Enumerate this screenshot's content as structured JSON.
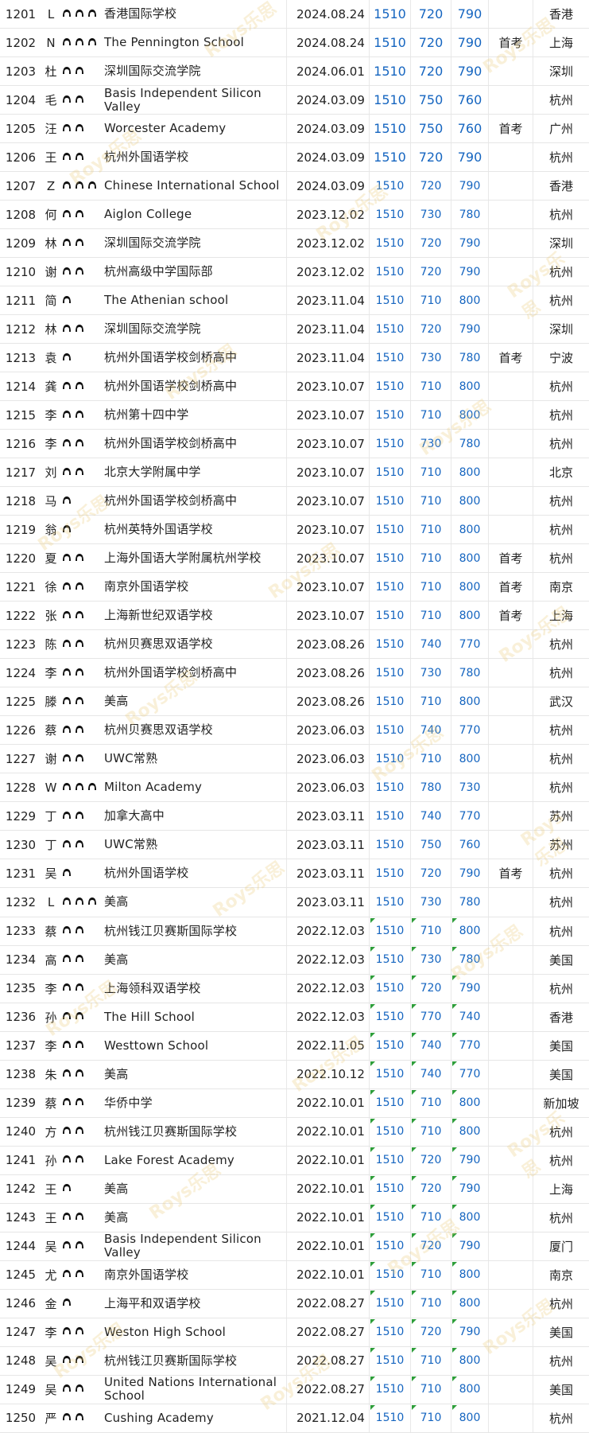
{
  "watermark": "Roys乐思",
  "rows": [
    {
      "id": "1201",
      "name": "L",
      "bulbs": 3,
      "school": "香港国际学校",
      "date": "2024.08.24",
      "total": "1510",
      "s1": "720",
      "s2": "790",
      "note": "",
      "city": "香港"
    },
    {
      "id": "1202",
      "name": "N",
      "bulbs": 3,
      "school": "The Pennington School",
      "date": "2024.08.24",
      "total": "1510",
      "s1": "720",
      "s2": "790",
      "note": "首考",
      "city": "上海"
    },
    {
      "id": "1203",
      "name": "杜",
      "bulbs": 2,
      "school": "深圳国际交流学院",
      "date": "2024.06.01",
      "total": "1510",
      "s1": "720",
      "s2": "790",
      "note": "",
      "city": "深圳"
    },
    {
      "id": "1204",
      "name": "毛",
      "bulbs": 2,
      "school": "Basis Independent Silicon Valley",
      "date": "2024.03.09",
      "total": "1510",
      "s1": "750",
      "s2": "760",
      "note": "",
      "city": "杭州"
    },
    {
      "id": "1205",
      "name": "汪",
      "bulbs": 2,
      "school": "Worcester Academy",
      "date": "2024.03.09",
      "total": "1510",
      "s1": "750",
      "s2": "760",
      "note": "首考",
      "city": "广州"
    },
    {
      "id": "1206",
      "name": "王",
      "bulbs": 2,
      "school": "杭州外国语学校",
      "date": "2024.03.09",
      "total": "1510",
      "s1": "720",
      "s2": "790",
      "note": "",
      "city": "杭州"
    },
    {
      "id": "1207",
      "name": "Z",
      "bulbs": 3,
      "school": "Chinese International School",
      "date": "2024.03.09",
      "total": "1510",
      "s1": "720",
      "s2": "790",
      "note": "",
      "city": "香港"
    },
    {
      "id": "1208",
      "name": "何",
      "bulbs": 2,
      "school": "Aiglon College",
      "date": "2023.12.02",
      "total": "1510",
      "s1": "730",
      "s2": "780",
      "note": "",
      "city": "杭州"
    },
    {
      "id": "1209",
      "name": "林",
      "bulbs": 2,
      "school": "深圳国际交流学院",
      "date": "2023.12.02",
      "total": "1510",
      "s1": "720",
      "s2": "790",
      "note": "",
      "city": "深圳"
    },
    {
      "id": "1210",
      "name": "谢",
      "bulbs": 2,
      "school": "杭州高级中学国际部",
      "date": "2023.12.02",
      "total": "1510",
      "s1": "720",
      "s2": "790",
      "note": "",
      "city": "杭州"
    },
    {
      "id": "1211",
      "name": "简",
      "bulbs": 1,
      "school": "The Athenian school",
      "date": "2023.11.04",
      "total": "1510",
      "s1": "710",
      "s2": "800",
      "note": "",
      "city": "杭州"
    },
    {
      "id": "1212",
      "name": "林",
      "bulbs": 2,
      "school": "深圳国际交流学院",
      "date": "2023.11.04",
      "total": "1510",
      "s1": "720",
      "s2": "790",
      "note": "",
      "city": "深圳"
    },
    {
      "id": "1213",
      "name": "袁",
      "bulbs": 1,
      "school": "杭州外国语学校剑桥高中",
      "date": "2023.11.04",
      "total": "1510",
      "s1": "730",
      "s2": "780",
      "note": "首考",
      "city": "宁波"
    },
    {
      "id": "1214",
      "name": "龚",
      "bulbs": 2,
      "school": "杭州外国语学校剑桥高中",
      "date": "2023.10.07",
      "total": "1510",
      "s1": "710",
      "s2": "800",
      "note": "",
      "city": "杭州"
    },
    {
      "id": "1215",
      "name": "李",
      "bulbs": 2,
      "school": "杭州第十四中学",
      "date": "2023.10.07",
      "total": "1510",
      "s1": "710",
      "s2": "800",
      "note": "",
      "city": "杭州"
    },
    {
      "id": "1216",
      "name": "李",
      "bulbs": 2,
      "school": "杭州外国语学校剑桥高中",
      "date": "2023.10.07",
      "total": "1510",
      "s1": "730",
      "s2": "780",
      "note": "",
      "city": "杭州"
    },
    {
      "id": "1217",
      "name": "刘",
      "bulbs": 2,
      "school": "北京大学附属中学",
      "date": "2023.10.07",
      "total": "1510",
      "s1": "710",
      "s2": "800",
      "note": "",
      "city": "北京"
    },
    {
      "id": "1218",
      "name": "马",
      "bulbs": 1,
      "school": "杭州外国语学校剑桥高中",
      "date": "2023.10.07",
      "total": "1510",
      "s1": "710",
      "s2": "800",
      "note": "",
      "city": "杭州"
    },
    {
      "id": "1219",
      "name": "翁",
      "bulbs": 1,
      "school": "杭州英特外国语学校",
      "date": "2023.10.07",
      "total": "1510",
      "s1": "710",
      "s2": "800",
      "note": "",
      "city": "杭州"
    },
    {
      "id": "1220",
      "name": "夏",
      "bulbs": 2,
      "school": "上海外国语大学附属杭州学校",
      "date": "2023.10.07",
      "total": "1510",
      "s1": "710",
      "s2": "800",
      "note": "首考",
      "city": "杭州"
    },
    {
      "id": "1221",
      "name": "徐",
      "bulbs": 2,
      "school": "南京外国语学校",
      "date": "2023.10.07",
      "total": "1510",
      "s1": "710",
      "s2": "800",
      "note": "首考",
      "city": "南京"
    },
    {
      "id": "1222",
      "name": "张",
      "bulbs": 2,
      "school": "上海新世纪双语学校",
      "date": "2023.10.07",
      "total": "1510",
      "s1": "710",
      "s2": "800",
      "note": "首考",
      "city": "上海"
    },
    {
      "id": "1223",
      "name": "陈",
      "bulbs": 2,
      "school": "杭州贝赛思双语学校",
      "date": "2023.08.26",
      "total": "1510",
      "s1": "740",
      "s2": "770",
      "note": "",
      "city": "杭州"
    },
    {
      "id": "1224",
      "name": "李",
      "bulbs": 2,
      "school": "杭州外国语学校剑桥高中",
      "date": "2023.08.26",
      "total": "1510",
      "s1": "730",
      "s2": "780",
      "note": "",
      "city": "杭州"
    },
    {
      "id": "1225",
      "name": "滕",
      "bulbs": 2,
      "school": "美高",
      "date": "2023.08.26",
      "total": "1510",
      "s1": "710",
      "s2": "800",
      "note": "",
      "city": "武汉"
    },
    {
      "id": "1226",
      "name": "蔡",
      "bulbs": 2,
      "school": "杭州贝赛思双语学校",
      "date": "2023.06.03",
      "total": "1510",
      "s1": "740",
      "s2": "770",
      "note": "",
      "city": "杭州"
    },
    {
      "id": "1227",
      "name": "谢",
      "bulbs": 2,
      "school": "UWC常熟",
      "date": "2023.06.03",
      "total": "1510",
      "s1": "710",
      "s2": "800",
      "note": "",
      "city": "杭州"
    },
    {
      "id": "1228",
      "name": "W",
      "bulbs": 3,
      "school": "Milton Academy",
      "date": "2023.06.03",
      "total": "1510",
      "s1": "780",
      "s2": "730",
      "note": "",
      "city": "杭州"
    },
    {
      "id": "1229",
      "name": "丁",
      "bulbs": 2,
      "school": "加拿大高中",
      "date": "2023.03.11",
      "total": "1510",
      "s1": "740",
      "s2": "770",
      "note": "",
      "city": "苏州"
    },
    {
      "id": "1230",
      "name": "丁",
      "bulbs": 2,
      "school": "UWC常熟",
      "date": "2023.03.11",
      "total": "1510",
      "s1": "750",
      "s2": "760",
      "note": "",
      "city": "苏州"
    },
    {
      "id": "1231",
      "name": "吴",
      "bulbs": 1,
      "school": "杭州外国语学校",
      "date": "2023.03.11",
      "total": "1510",
      "s1": "720",
      "s2": "790",
      "note": "首考",
      "city": "杭州"
    },
    {
      "id": "1232",
      "name": "L",
      "bulbs": 3,
      "school": "美高",
      "date": "2023.03.11",
      "total": "1510",
      "s1": "730",
      "s2": "780",
      "note": "",
      "city": "杭州"
    },
    {
      "id": "1233",
      "name": "蔡",
      "bulbs": 2,
      "school": "杭州钱江贝赛斯国际学校",
      "date": "2022.12.03",
      "total": "1510",
      "s1": "710",
      "s2": "800",
      "note": "",
      "city": "杭州",
      "flag": true
    },
    {
      "id": "1234",
      "name": "高",
      "bulbs": 2,
      "school": "美高",
      "date": "2022.12.03",
      "total": "1510",
      "s1": "730",
      "s2": "780",
      "note": "",
      "city": "美国",
      "flag": true
    },
    {
      "id": "1235",
      "name": "李",
      "bulbs": 2,
      "school": "上海领科双语学校",
      "date": "2022.12.03",
      "total": "1510",
      "s1": "720",
      "s2": "790",
      "note": "",
      "city": "杭州",
      "flag": true
    },
    {
      "id": "1236",
      "name": "孙",
      "bulbs": 2,
      "school": "The Hill School",
      "date": "2022.12.03",
      "total": "1510",
      "s1": "770",
      "s2": "740",
      "note": "",
      "city": "香港",
      "flag": true
    },
    {
      "id": "1237",
      "name": "李",
      "bulbs": 2,
      "school": "Westtown School",
      "date": "2022.11.05",
      "total": "1510",
      "s1": "740",
      "s2": "770",
      "note": "",
      "city": "美国",
      "flag": true
    },
    {
      "id": "1238",
      "name": "朱",
      "bulbs": 2,
      "school": "美高",
      "date": "2022.10.12",
      "total": "1510",
      "s1": "740",
      "s2": "770",
      "note": "",
      "city": "美国",
      "flag": true
    },
    {
      "id": "1239",
      "name": "蔡",
      "bulbs": 2,
      "school": "华侨中学",
      "date": "2022.10.01",
      "total": "1510",
      "s1": "710",
      "s2": "800",
      "note": "",
      "city": "新加坡",
      "flag": true
    },
    {
      "id": "1240",
      "name": "方",
      "bulbs": 2,
      "school": "杭州钱江贝赛斯国际学校",
      "date": "2022.10.01",
      "total": "1510",
      "s1": "710",
      "s2": "800",
      "note": "",
      "city": "杭州",
      "flag": true
    },
    {
      "id": "1241",
      "name": "孙",
      "bulbs": 2,
      "school": "Lake Forest Academy",
      "date": "2022.10.01",
      "total": "1510",
      "s1": "720",
      "s2": "790",
      "note": "",
      "city": "杭州",
      "flag": true
    },
    {
      "id": "1242",
      "name": "王",
      "bulbs": 1,
      "school": "美高",
      "date": "2022.10.01",
      "total": "1510",
      "s1": "720",
      "s2": "790",
      "note": "",
      "city": "上海",
      "flag": true
    },
    {
      "id": "1243",
      "name": "王",
      "bulbs": 2,
      "school": "美高",
      "date": "2022.10.01",
      "total": "1510",
      "s1": "710",
      "s2": "800",
      "note": "",
      "city": "杭州",
      "flag": true
    },
    {
      "id": "1244",
      "name": "吴",
      "bulbs": 2,
      "school": "Basis Independent Silicon Valley",
      "date": "2022.10.01",
      "total": "1510",
      "s1": "720",
      "s2": "790",
      "note": "",
      "city": "厦门",
      "flag": true
    },
    {
      "id": "1245",
      "name": "尤",
      "bulbs": 2,
      "school": "南京外国语学校",
      "date": "2022.10.01",
      "total": "1510",
      "s1": "710",
      "s2": "800",
      "note": "",
      "city": "南京",
      "flag": true
    },
    {
      "id": "1246",
      "name": "金",
      "bulbs": 1,
      "school": "上海平和双语学校",
      "date": "2022.08.27",
      "total": "1510",
      "s1": "710",
      "s2": "800",
      "note": "",
      "city": "杭州",
      "flag": true
    },
    {
      "id": "1247",
      "name": "李",
      "bulbs": 2,
      "school": "Weston High School",
      "date": "2022.08.27",
      "total": "1510",
      "s1": "720",
      "s2": "790",
      "note": "",
      "city": "美国",
      "flag": true
    },
    {
      "id": "1248",
      "name": "吴",
      "bulbs": 2,
      "school": "杭州钱江贝赛斯国际学校",
      "date": "2022.08.27",
      "total": "1510",
      "s1": "710",
      "s2": "800",
      "note": "",
      "city": "杭州",
      "flag": true
    },
    {
      "id": "1249",
      "name": "吴",
      "bulbs": 2,
      "school": "United Nations International School",
      "date": "2022.08.27",
      "total": "1510",
      "s1": "710",
      "s2": "800",
      "note": "",
      "city": "美国",
      "flag": true
    },
    {
      "id": "1250",
      "name": "严",
      "bulbs": 2,
      "school": "Cushing Academy",
      "date": "2021.12.04",
      "total": "1510",
      "s1": "710",
      "s2": "800",
      "note": "",
      "city": "杭州",
      "flag": true
    }
  ]
}
